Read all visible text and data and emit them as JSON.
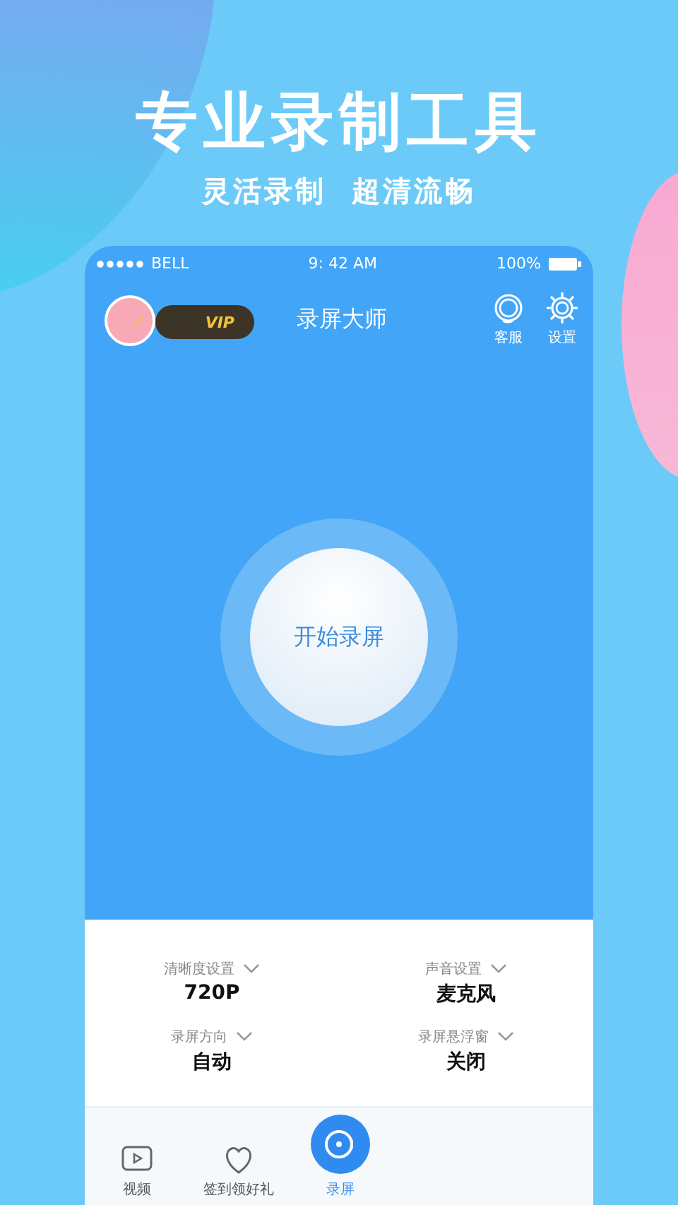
{
  "headline": "专业录制工具",
  "subheadline": "灵活录制  超清流畅",
  "status_bar": {
    "carrier": "BELL",
    "time": "9: 42 AM",
    "battery": "100%"
  },
  "header": {
    "badge": "VIP",
    "title": "录屏大师",
    "actions": [
      {
        "kind": "service",
        "label": "客服"
      },
      {
        "kind": "settings",
        "label": "设置"
      }
    ]
  },
  "record_button": {
    "label": "开始录屏"
  },
  "settings": [
    {
      "label": "清晰度设置",
      "value": "720P"
    },
    {
      "label": "声音设置",
      "value": "麦克风"
    },
    {
      "label": "录屏方向",
      "value": "自动"
    },
    {
      "label": "录屏悬浮窗",
      "value": "关闭"
    }
  ],
  "tabs": [
    {
      "kind": "video",
      "label": "视频",
      "selected": false
    },
    {
      "kind": "gift",
      "label": "签到领好礼",
      "selected": false
    },
    {
      "kind": "record",
      "label": "录屏",
      "selected": true
    }
  ]
}
